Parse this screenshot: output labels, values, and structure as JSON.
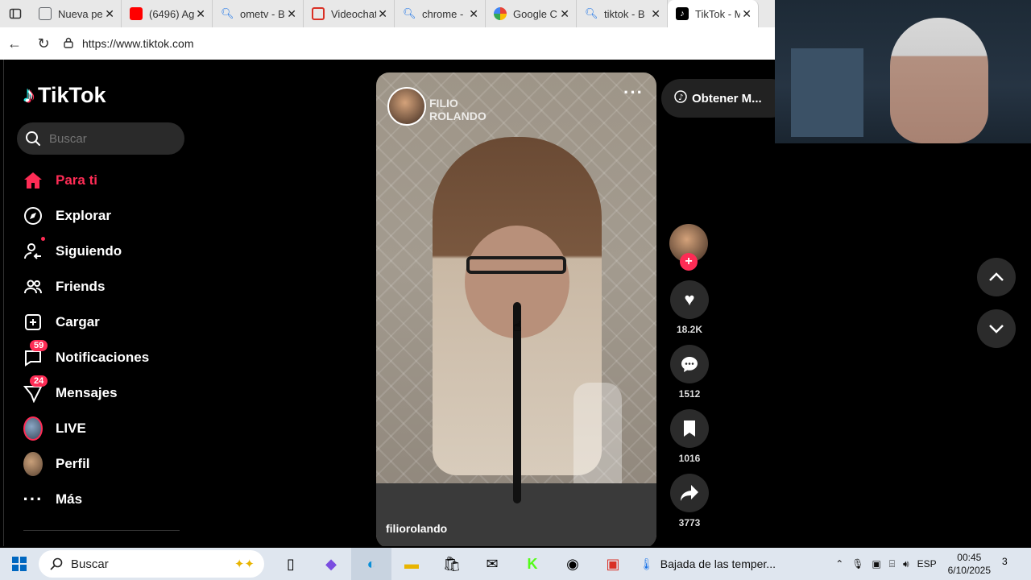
{
  "browser": {
    "tabs": [
      {
        "title": "Nueva pe",
        "color": "#5f6368"
      },
      {
        "title": "(6496) Ag",
        "color": "#ff0000"
      },
      {
        "title": "ometv - B",
        "color": "#1a73e8"
      },
      {
        "title": "Videochat",
        "color": "#d93025"
      },
      {
        "title": "chrome -",
        "color": "#1a73e8"
      },
      {
        "title": "Google C",
        "color": "#fbbc04"
      },
      {
        "title": "tiktok - B",
        "color": "#1a73e8"
      },
      {
        "title": "TikTok - M",
        "color": "#000000"
      }
    ],
    "url": "https://www.tiktok.com"
  },
  "sidebar": {
    "logo": "TikTok",
    "search_placeholder": "Buscar",
    "items": [
      {
        "label": "Para ti",
        "icon": "home-icon"
      },
      {
        "label": "Explorar",
        "icon": "compass-icon"
      },
      {
        "label": "Siguiendo",
        "icon": "following-icon"
      },
      {
        "label": "Friends",
        "icon": "friends-icon"
      },
      {
        "label": "Cargar",
        "icon": "upload-icon"
      },
      {
        "label": "Notificaciones",
        "icon": "notifications-icon",
        "badge": "59"
      },
      {
        "label": "Mensajes",
        "icon": "messages-icon",
        "badge": "24"
      },
      {
        "label": "LIVE",
        "icon": "live-avatar"
      },
      {
        "label": "Perfil",
        "icon": "profile-avatar"
      },
      {
        "label": "Más",
        "icon": "more-icon"
      }
    ]
  },
  "video": {
    "watermark": "FILIO ROLANDO",
    "username": "filiorolando"
  },
  "get_app": "Obtener M...",
  "actions": {
    "likes": "18.2K",
    "comments": "1512",
    "saves": "1016",
    "shares": "3773"
  },
  "taskbar": {
    "search": "Buscar",
    "news": "Bajada de las temper...",
    "lang": "ESP",
    "time": "00:45",
    "date": "6/10/2025",
    "notifications": "3"
  },
  "colors": {
    "accent": "#fe2c55",
    "background": "#000000"
  }
}
